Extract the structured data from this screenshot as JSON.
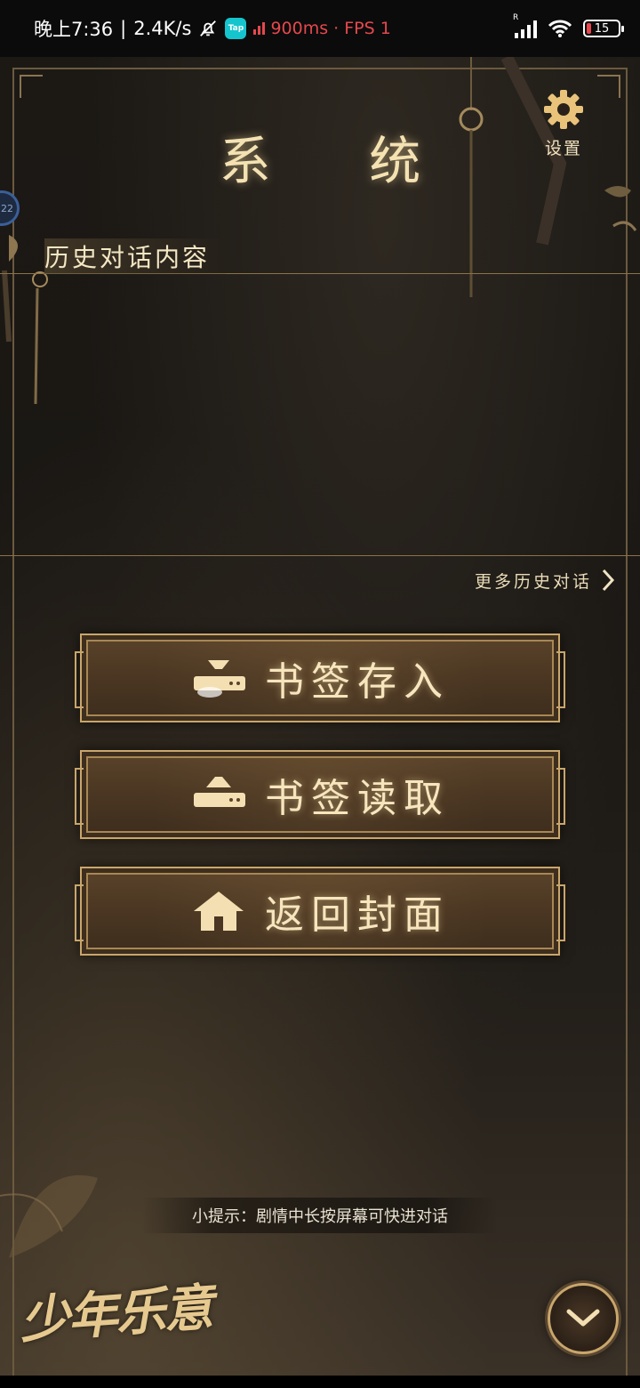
{
  "status_bar": {
    "time": "晚上7:36",
    "speed": "2.4K/s",
    "tap_label": "Tap",
    "network": "900ms · FPS 1",
    "signal_tag": "R",
    "battery": "15"
  },
  "header": {
    "title": "系 统",
    "settings_label": "设置"
  },
  "history": {
    "section_title": "历史对话内容",
    "more_link": "更多历史对话"
  },
  "menu": {
    "bookmark_save": "书签存入",
    "bookmark_load": "书签读取",
    "return_cover": "返回封面"
  },
  "tip": "小提示：剧情中长按屏幕可快进对话",
  "logo_text": "少年乐意",
  "avatar_badge": "22",
  "colors": {
    "gold": "#c9a66b",
    "text_cream": "#f4e2b3",
    "background": "#1c1915",
    "button_fill": "#4a3622",
    "network_red": "#e5484d"
  },
  "icons": {
    "settings": "gear-icon",
    "bookmark_save": "bookmark-save-icon",
    "bookmark_load": "bookmark-load-icon",
    "return_cover": "home-icon",
    "more": "chevron-right-icon",
    "collapse": "chevron-down-icon"
  }
}
